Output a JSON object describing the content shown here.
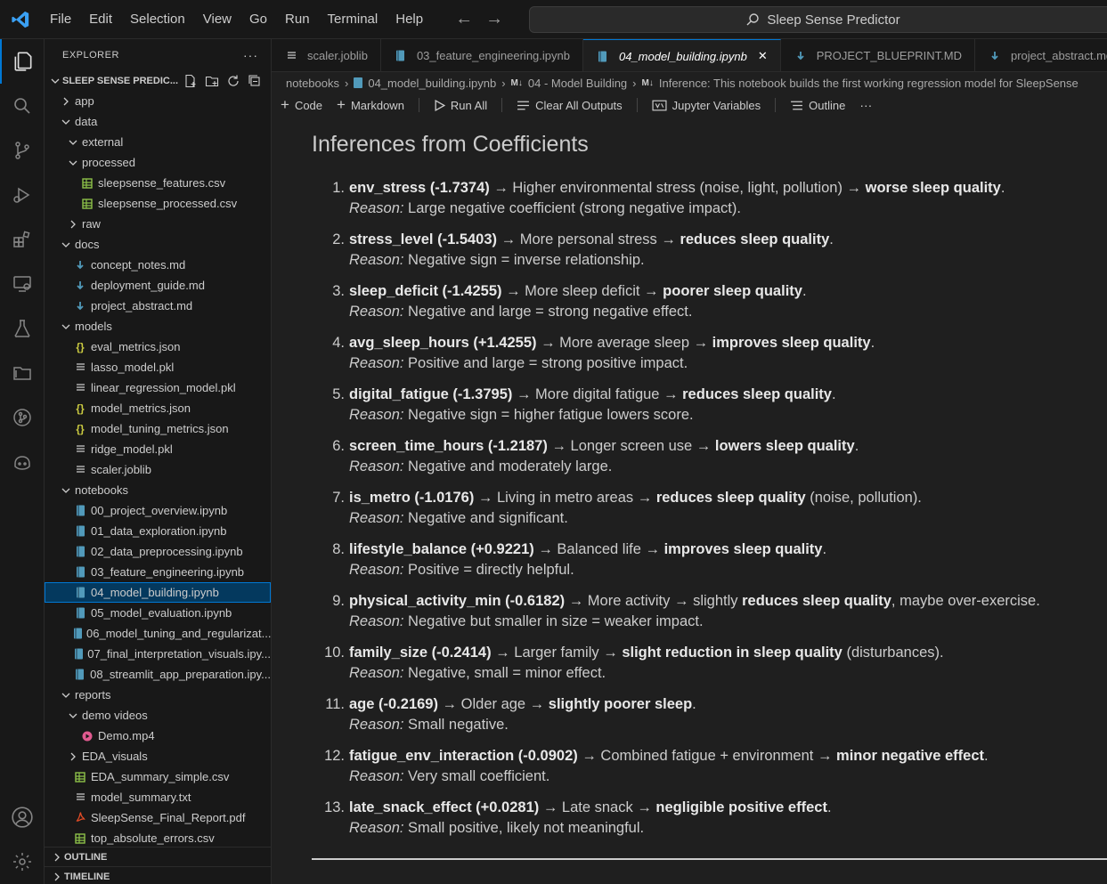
{
  "menu": [
    "File",
    "Edit",
    "Selection",
    "View",
    "Go",
    "Run",
    "Terminal",
    "Help"
  ],
  "command_center": {
    "text": "Sleep Sense Predictor"
  },
  "sidebar": {
    "title": "EXPLORER",
    "project": "SLEEP SENSE PREDIC...",
    "tree": [
      {
        "label": "app",
        "type": "folder",
        "open": false,
        "depth": 0
      },
      {
        "label": "data",
        "type": "folder",
        "open": true,
        "depth": 0
      },
      {
        "label": "external",
        "type": "folder",
        "open": true,
        "depth": 1
      },
      {
        "label": "processed",
        "type": "folder",
        "open": true,
        "depth": 1
      },
      {
        "label": "sleepsense_features.csv",
        "type": "csv",
        "depth": 2
      },
      {
        "label": "sleepsense_processed.csv",
        "type": "csv",
        "depth": 2
      },
      {
        "label": "raw",
        "type": "folder",
        "open": false,
        "depth": 1
      },
      {
        "label": "docs",
        "type": "folder",
        "open": true,
        "depth": 0
      },
      {
        "label": "concept_notes.md",
        "type": "md",
        "depth": 1
      },
      {
        "label": "deployment_guide.md",
        "type": "md",
        "depth": 1
      },
      {
        "label": "project_abstract.md",
        "type": "md",
        "depth": 1
      },
      {
        "label": "models",
        "type": "folder",
        "open": true,
        "depth": 0
      },
      {
        "label": "eval_metrics.json",
        "type": "json",
        "depth": 1
      },
      {
        "label": "lasso_model.pkl",
        "type": "txt",
        "depth": 1
      },
      {
        "label": "linear_regression_model.pkl",
        "type": "txt",
        "depth": 1
      },
      {
        "label": "model_metrics.json",
        "type": "json",
        "depth": 1
      },
      {
        "label": "model_tuning_metrics.json",
        "type": "json",
        "depth": 1
      },
      {
        "label": "ridge_model.pkl",
        "type": "txt",
        "depth": 1
      },
      {
        "label": "scaler.joblib",
        "type": "txt",
        "depth": 1
      },
      {
        "label": "notebooks",
        "type": "folder",
        "open": true,
        "depth": 0
      },
      {
        "label": "00_project_overview.ipynb",
        "type": "nb",
        "depth": 1
      },
      {
        "label": "01_data_exploration.ipynb",
        "type": "nb",
        "depth": 1
      },
      {
        "label": "02_data_preprocessing.ipynb",
        "type": "nb",
        "depth": 1
      },
      {
        "label": "03_feature_engineering.ipynb",
        "type": "nb",
        "depth": 1
      },
      {
        "label": "04_model_building.ipynb",
        "type": "nb",
        "depth": 1,
        "selected": true
      },
      {
        "label": "05_model_evaluation.ipynb",
        "type": "nb",
        "depth": 1
      },
      {
        "label": "06_model_tuning_and_regularizat...",
        "type": "nb",
        "depth": 1
      },
      {
        "label": "07_final_interpretation_visuals.ipy...",
        "type": "nb",
        "depth": 1
      },
      {
        "label": "08_streamlit_app_preparation.ipy...",
        "type": "nb",
        "depth": 1
      },
      {
        "label": "reports",
        "type": "folder",
        "open": true,
        "depth": 0
      },
      {
        "label": "demo videos",
        "type": "folder",
        "open": true,
        "depth": 1
      },
      {
        "label": "Demo.mp4",
        "type": "video",
        "depth": 2
      },
      {
        "label": "EDA_visuals",
        "type": "folder",
        "open": false,
        "depth": 1
      },
      {
        "label": "EDA_summary_simple.csv",
        "type": "csv",
        "depth": 1
      },
      {
        "label": "model_summary.txt",
        "type": "txt",
        "depth": 1
      },
      {
        "label": "SleepSense_Final_Report.pdf",
        "type": "pdf",
        "depth": 1
      },
      {
        "label": "top_absolute_errors.csv",
        "type": "csv",
        "depth": 1
      }
    ],
    "outline_label": "OUTLINE",
    "timeline_label": "TIMELINE"
  },
  "tabs": [
    {
      "label": "scaler.joblib",
      "icon": "txt"
    },
    {
      "label": "03_feature_engineering.ipynb",
      "icon": "nb"
    },
    {
      "label": "04_model_building.ipynb",
      "icon": "nb",
      "active": true
    },
    {
      "label": "PROJECT_BLUEPRINT.MD",
      "icon": "md"
    },
    {
      "label": "project_abstract.md",
      "icon": "md"
    }
  ],
  "breadcrumb": {
    "folder": "notebooks",
    "file": "04_model_building.ipynb",
    "cell1": "04 - Model Building",
    "cell2": "Inference: This notebook builds the first working regression model for SleepSense"
  },
  "toolbar": {
    "code": "Code",
    "markdown": "Markdown",
    "run_all": "Run All",
    "clear_outputs": "Clear All Outputs",
    "variables": "Jupyter Variables",
    "outline": "Outline"
  },
  "notebook": {
    "heading": "Inferences from Coefficients",
    "reason_label": "Reason:",
    "items": [
      {
        "num": "1.",
        "feature": "env_stress (-1.7374)",
        "effect": " → Higher environmental stress (noise, light, pollution) → ",
        "conclusion": "worse sleep quality",
        "tail": ".",
        "reason": " Large negative coefficient (strong negative impact)."
      },
      {
        "num": "2.",
        "feature": "stress_level (-1.5403)",
        "effect": " → More personal stress → ",
        "conclusion": "reduces sleep quality",
        "tail": ".",
        "reason": " Negative sign = inverse relationship."
      },
      {
        "num": "3.",
        "feature": "sleep_deficit (-1.4255)",
        "effect": " → More sleep deficit → ",
        "conclusion": "poorer sleep quality",
        "tail": ".",
        "reason": " Negative and large = strong negative effect."
      },
      {
        "num": "4.",
        "feature": "avg_sleep_hours (+1.4255)",
        "effect": " → More average sleep → ",
        "conclusion": "improves sleep quality",
        "tail": ".",
        "reason": " Positive and large = strong positive impact."
      },
      {
        "num": "5.",
        "feature": "digital_fatigue (-1.3795)",
        "effect": " → More digital fatigue → ",
        "conclusion": "reduces sleep quality",
        "tail": ".",
        "reason": " Negative sign = higher fatigue lowers score."
      },
      {
        "num": "6.",
        "feature": "screen_time_hours (-1.2187)",
        "effect": " → Longer screen use → ",
        "conclusion": "lowers sleep quality",
        "tail": ".",
        "reason": " Negative and moderately large."
      },
      {
        "num": "7.",
        "feature": "is_metro (-1.0176)",
        "effect": " → Living in metro areas → ",
        "conclusion": "reduces sleep quality",
        "tail": " (noise, pollution).",
        "reason": " Negative and significant."
      },
      {
        "num": "8.",
        "feature": "lifestyle_balance (+0.9221)",
        "effect": " → Balanced life → ",
        "conclusion": "improves sleep quality",
        "tail": ".",
        "reason": " Positive = directly helpful."
      },
      {
        "num": "9.",
        "feature": "physical_activity_min (-0.6182)",
        "effect": " → More activity → slightly ",
        "conclusion": "reduces sleep quality",
        "tail": ", maybe over-exercise.",
        "reason": " Negative but smaller in size = weaker impact."
      },
      {
        "num": "10.",
        "feature": "family_size (-0.2414)",
        "effect": " → Larger family → ",
        "conclusion": "slight reduction in sleep quality",
        "tail": " (disturbances).",
        "reason": " Negative, small = minor effect."
      },
      {
        "num": "11.",
        "feature": "age (-0.2169)",
        "effect": " → Older age → ",
        "conclusion": "slightly poorer sleep",
        "tail": ".",
        "reason": " Small negative."
      },
      {
        "num": "12.",
        "feature": "fatigue_env_interaction (-0.0902)",
        "effect": " → Combined fatigue + environment → ",
        "conclusion": "minor negative effect",
        "tail": ".",
        "reason": " Very small coefficient."
      },
      {
        "num": "13.",
        "feature": "late_snack_effect (+0.0281)",
        "effect": " → Late snack → ",
        "conclusion": "negligible positive effect",
        "tail": ".",
        "reason": " Small positive, likely not meaningful."
      }
    ]
  },
  "colors": {
    "accent": "#0078d4",
    "folder_chevron": "#cccccc",
    "csv": "#8dc149",
    "md": "#519aba",
    "json": "#cbcb41",
    "notebook": "#519aba",
    "pdf": "#e34c26",
    "video": "#e05a8f"
  }
}
